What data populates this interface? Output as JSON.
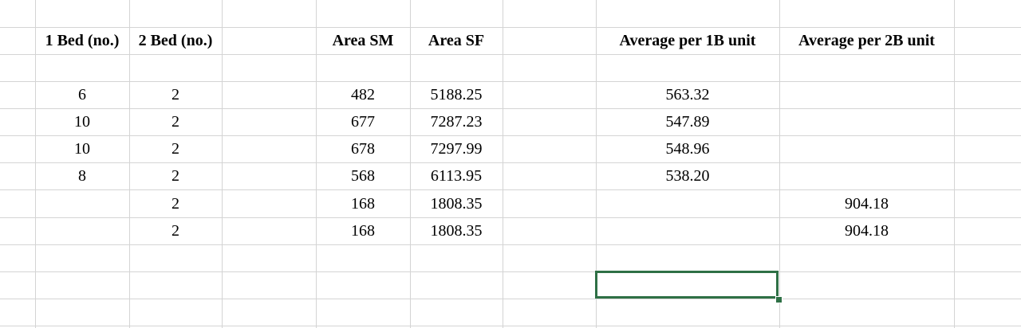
{
  "headers": {
    "bed1": "1 Bed (no.)",
    "bed2": "2 Bed (no.)",
    "area_sm": "Area SM",
    "area_sf": "Area SF",
    "avg_1b": "Average per 1B unit",
    "avg_2b": "Average per 2B unit"
  },
  "rows": [
    {
      "bed1": "6",
      "bed2": "2",
      "area_sm": "482",
      "area_sf": "5188.25",
      "avg_1b": "563.32",
      "avg_2b": ""
    },
    {
      "bed1": "10",
      "bed2": "2",
      "area_sm": "677",
      "area_sf": "7287.23",
      "avg_1b": "547.89",
      "avg_2b": ""
    },
    {
      "bed1": "10",
      "bed2": "2",
      "area_sm": "678",
      "area_sf": "7297.99",
      "avg_1b": "548.96",
      "avg_2b": ""
    },
    {
      "bed1": "8",
      "bed2": "2",
      "area_sm": "568",
      "area_sf": "6113.95",
      "avg_1b": "538.20",
      "avg_2b": ""
    },
    {
      "bed1": "",
      "bed2": "2",
      "area_sm": "168",
      "area_sf": "1808.35",
      "avg_1b": "",
      "avg_2b": "904.18"
    },
    {
      "bed1": "",
      "bed2": "2",
      "area_sm": "168",
      "area_sf": "1808.35",
      "avg_1b": "",
      "avg_2b": "904.18"
    }
  ],
  "colors": {
    "gridline": "#d4d4d4",
    "selection": "#2e7045"
  }
}
